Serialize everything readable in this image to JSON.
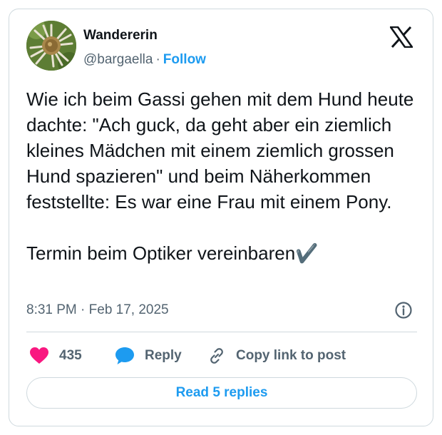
{
  "author": {
    "name": "Wandererin",
    "handle": "@bargaella",
    "separator": "·",
    "follow_label": "Follow"
  },
  "brand_icon": "x-logo-icon",
  "tweet": {
    "paragraphs": [
      "Wie ich beim Gassi gehen mit dem Hund heute dachte: \"Ach guck, da geht aber ein ziemlich kleines Mädchen mit einem ziemlich grossen Hund spazieren\" und beim Näherkommen feststellte: Es war eine Frau mit einem Pony.",
      "Termin beim Optiker vereinbaren✔️"
    ]
  },
  "timestamp": "8:31 PM · Feb 17, 2025",
  "actions": {
    "like_count": "435",
    "reply_label": "Reply",
    "copy_label": "Copy link to post"
  },
  "read_replies_label": "Read 5 replies",
  "colors": {
    "accent": "#1d9bf0",
    "like": "#f91880",
    "text": "#0f1419",
    "secondary": "#536471",
    "border": "#cfd9de"
  }
}
